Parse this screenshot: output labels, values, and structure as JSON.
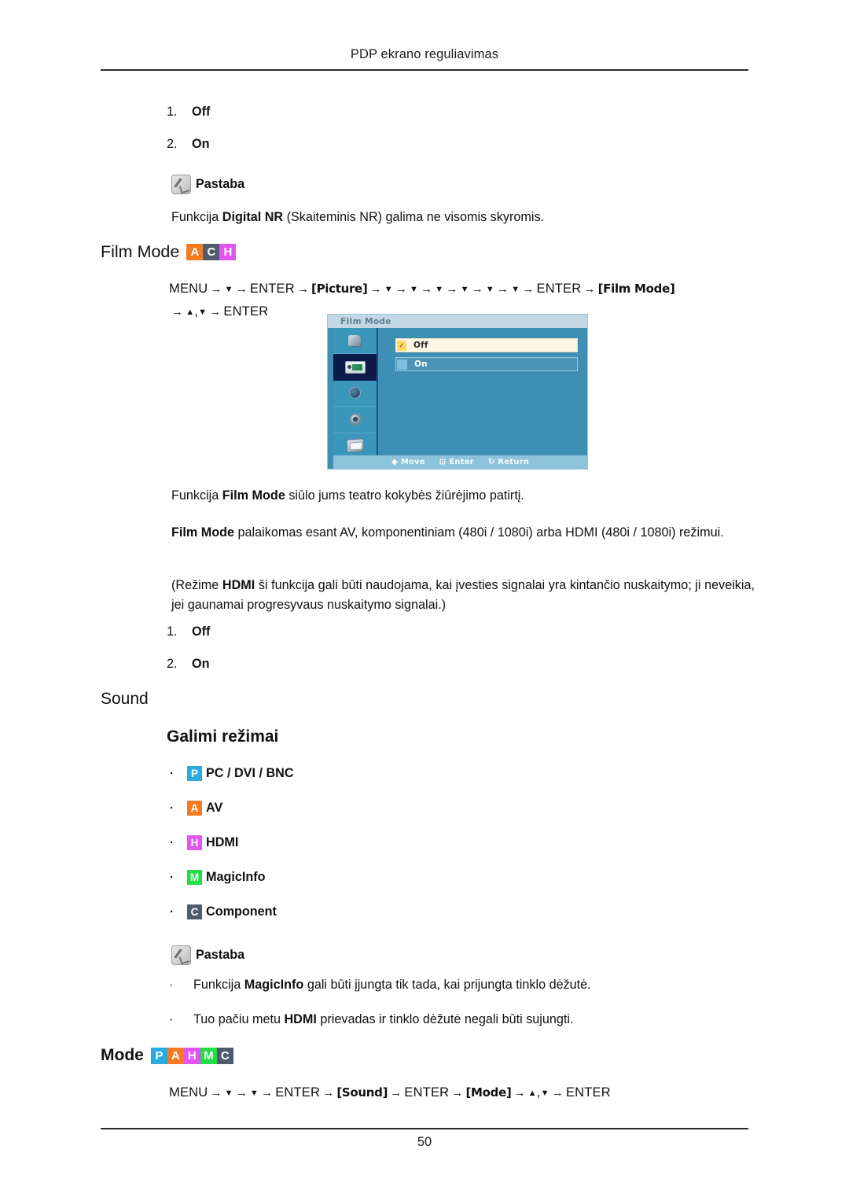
{
  "header": {
    "running_title": "PDP ekrano reguliavimas"
  },
  "footer": {
    "page_number": "50"
  },
  "note_label": "Pastaba",
  "digital_nr_section": {
    "options": [
      {
        "num": "1.",
        "label": "Off"
      },
      {
        "num": "2.",
        "label": "On"
      }
    ],
    "note_text_pre": "Funkcija ",
    "note_text_bold": "Digital NR",
    "note_text_post": " (Skaiteminis NR) galima ne visomis skyromis."
  },
  "film_mode": {
    "heading": "Film Mode",
    "badges": [
      {
        "letter": "A",
        "color": "#f47b20"
      },
      {
        "letter": "C",
        "color": "#515b6e"
      },
      {
        "letter": "H",
        "color": "#e355f0"
      }
    ],
    "menu_path": {
      "menu": "MENU",
      "enter": "ENTER",
      "picture_label": "Picture",
      "film_mode_label": "Film Mode",
      "down_glyph": "▼",
      "up_glyph": "▲",
      "arrow": "→",
      "comma": ","
    },
    "osd": {
      "title": "Film Mode",
      "rows": [
        {
          "label": "Off",
          "selected": true
        },
        {
          "label": "On",
          "selected": false
        }
      ],
      "footer": [
        {
          "glyph": "◆",
          "label": "Move"
        },
        {
          "glyph": "⊡",
          "label": "Enter"
        },
        {
          "glyph": "↻",
          "label": "Return"
        }
      ],
      "check_glyph": "✓"
    },
    "paragraphs": [
      {
        "pre": "Funkcija ",
        "bold": "Film Mode",
        "post": " siūlo jums teatro kokybės žiūrėjimo patirtį."
      },
      {
        "pre": "",
        "bold": "Film Mode",
        "post": " palaikomas esant AV, komponentiniam (480i / 1080i) arba HDMI (480i / 1080i) režimui."
      },
      {
        "pre": "(Režime ",
        "bold": "HDMI",
        "post": " ši funkcija gali būti naudojama, kai įvesties signalai yra kintančio nuskaitymo; ji neveikia, jei gaunamai progresyvaus nuskaitymo signalai.)"
      }
    ],
    "options": [
      {
        "num": "1.",
        "label": "Off"
      },
      {
        "num": "2.",
        "label": "On"
      }
    ]
  },
  "sound": {
    "heading": "Sound",
    "available_modes_heading": "Galimi režimai",
    "bullet_glyph": "·",
    "modes": [
      {
        "letter": "P",
        "color": "#29abe2",
        "label": "PC / DVI / BNC"
      },
      {
        "letter": "A",
        "color": "#f47b20",
        "label": "AV"
      },
      {
        "letter": "H",
        "color": "#e355f0",
        "label": "HDMI"
      },
      {
        "letter": "M",
        "color": "#22dd44",
        "label": "MagicInfo"
      },
      {
        "letter": "C",
        "color": "#515b6e",
        "label": "Component"
      }
    ],
    "notes": [
      {
        "pre": "Funkcija ",
        "bold": "MagicInfo",
        "post": " gali būti įjungta tik tada, kai prijungta tinklo dėžutė."
      },
      {
        "pre": "Tuo pačiu metu ",
        "bold": "HDMI",
        "post": " prievadas ir tinklo dėžutė negali būti sujungti."
      }
    ]
  },
  "mode_section": {
    "heading": "Mode",
    "badges": [
      {
        "letter": "P",
        "color": "#29abe2"
      },
      {
        "letter": "A",
        "color": "#f47b20"
      },
      {
        "letter": "H",
        "color": "#e355f0"
      },
      {
        "letter": "M",
        "color": "#22dd44"
      },
      {
        "letter": "C",
        "color": "#515b6e"
      }
    ],
    "menu_path": {
      "menu": "MENU",
      "enter": "ENTER",
      "sound_label": "Sound",
      "mode_label": "Mode",
      "down_glyph": "▼",
      "up_glyph": "▲",
      "arrow": "→",
      "comma": ","
    }
  }
}
